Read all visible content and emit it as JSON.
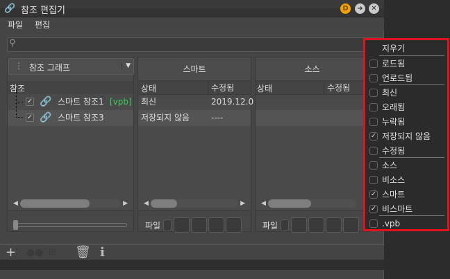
{
  "window": {
    "title": "참조 편집기"
  },
  "menubar": {
    "file": "파일",
    "edit": "편집"
  },
  "search": {
    "placeholder": ""
  },
  "left_panel": {
    "dropdown": "참조 그래프",
    "column": "참조",
    "items": [
      {
        "label": "스마트 참조1",
        "tag": "[vpb]",
        "checked": true
      },
      {
        "label": "스마트 참조3",
        "checked": true
      }
    ]
  },
  "smart_panel": {
    "title": "스마트",
    "columns": [
      "상태",
      "수정됨"
    ],
    "rows": [
      [
        "최신",
        "2019.12.0"
      ],
      [
        "저장되지 않음",
        "----"
      ]
    ],
    "footer_label": "파일"
  },
  "source_panel": {
    "title": "소스",
    "columns": [
      "상태",
      "수정됨"
    ],
    "footer_label": "파일"
  },
  "filter_menu": {
    "clear": "지우기",
    "items": [
      {
        "label": "로드됨",
        "checked": false
      },
      {
        "label": "언로드됨",
        "checked": false
      },
      {
        "label": "최신",
        "checked": false
      },
      {
        "label": "오래됨",
        "checked": false
      },
      {
        "label": "누락됨",
        "checked": false
      },
      {
        "label": "저장되지 않음",
        "checked": true
      },
      {
        "label": "수정됨",
        "checked": false
      },
      {
        "label": "소스",
        "checked": false
      },
      {
        "label": "비소스",
        "checked": false
      },
      {
        "label": "스마트",
        "checked": true
      },
      {
        "label": "비스마트",
        "checked": true
      },
      {
        "label": ".vpb",
        "checked": false
      }
    ]
  },
  "colors": {
    "accent_green": "#3ecf5a",
    "menu_border": "#e0141e",
    "badge": "#f0a500"
  }
}
